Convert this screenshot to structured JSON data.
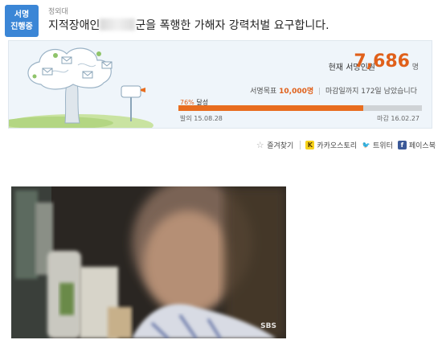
{
  "badge": {
    "line1": "서명",
    "line2": "진행중"
  },
  "author": "정외대",
  "title": {
    "before": "지적장애인",
    "after": "군을 폭행한 가해자 강력처벌 요구합니다."
  },
  "signature": {
    "current_label": "현재 서명인원",
    "current_count": "7,686",
    "unit": "명",
    "goal_label": "서명목표",
    "goal_value": "10,000명",
    "deadline_prefix": "마감일까지",
    "deadline_days": "172일",
    "deadline_suffix": "남았습니다",
    "percent": "76%",
    "percent_suffix": "달성",
    "progress_fraction": 0.76,
    "start_date": "발의 15.08.28",
    "end_date": "마감 16.02.27"
  },
  "share": {
    "bookmark_label": "즐겨찾기",
    "kakao_label": "카카오스토리",
    "twitter_label": "트위터",
    "facebook_label": "페이스북",
    "kakao_icon": "K",
    "facebook_icon": "f",
    "star_icon": "☆",
    "twitter_icon": "🐦"
  },
  "video": {
    "watermark": "SBS"
  },
  "colors": {
    "badge": "#3b86d6",
    "accent": "#e0601a",
    "bar_fill": "#e86d1f"
  }
}
